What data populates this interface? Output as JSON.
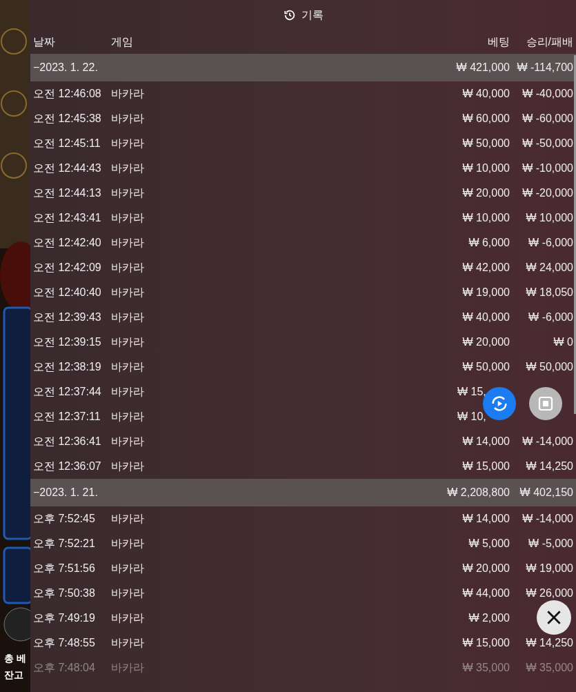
{
  "title": "기록",
  "columns": [
    "날짜",
    "게임",
    "베팅",
    "승리/패배"
  ],
  "groups": [
    {
      "date": "−2023. 1. 22.",
      "bet": "₩ 421,000",
      "win": "₩ -114,700",
      "rows": [
        {
          "time": "오전 12:46:08",
          "game": "바카라",
          "bet": "₩ 40,000",
          "win": "₩ -40,000"
        },
        {
          "time": "오전 12:45:38",
          "game": "바카라",
          "bet": "₩ 60,000",
          "win": "₩ -60,000"
        },
        {
          "time": "오전 12:45:11",
          "game": "바카라",
          "bet": "₩ 50,000",
          "win": "₩ -50,000"
        },
        {
          "time": "오전 12:44:43",
          "game": "바카라",
          "bet": "₩ 10,000",
          "win": "₩ -10,000"
        },
        {
          "time": "오전 12:44:13",
          "game": "바카라",
          "bet": "₩ 20,000",
          "win": "₩ -20,000"
        },
        {
          "time": "오전 12:43:41",
          "game": "바카라",
          "bet": "₩ 10,000",
          "win": "₩ 10,000"
        },
        {
          "time": "오전 12:42:40",
          "game": "바카라",
          "bet": "₩ 6,000",
          "win": "₩ -6,000"
        },
        {
          "time": "오전 12:42:09",
          "game": "바카라",
          "bet": "₩ 42,000",
          "win": "₩ 24,000"
        },
        {
          "time": "오전 12:40:40",
          "game": "바카라",
          "bet": "₩ 19,000",
          "win": "₩ 18,050"
        },
        {
          "time": "오전 12:39:43",
          "game": "바카라",
          "bet": "₩ 40,000",
          "win": "₩ -6,000"
        },
        {
          "time": "오전 12:39:15",
          "game": "바카라",
          "bet": "₩ 20,000",
          "win": "₩ 0"
        },
        {
          "time": "오전 12:38:19",
          "game": "바카라",
          "bet": "₩ 50,000",
          "win": "₩ 50,000"
        },
        {
          "time": "오전 12:37:44",
          "game": "바카라",
          "bet": "₩ 15,",
          "covered": true
        },
        {
          "time": "오전 12:37:11",
          "game": "바카라",
          "bet": "₩ 10,",
          "covered": true
        },
        {
          "time": "오전 12:36:41",
          "game": "바카라",
          "bet": "₩ 14,000",
          "win": "₩ -14,000"
        },
        {
          "time": "오전 12:36:07",
          "game": "바카라",
          "bet": "₩ 15,000",
          "win": "₩ 14,250"
        }
      ]
    },
    {
      "date": "−2023. 1. 21.",
      "bet": "₩ 2,208,800",
      "win": "₩ 402,150",
      "rows": [
        {
          "time": "오후 7:52:45",
          "game": "바카라",
          "bet": "₩ 14,000",
          "win": "₩ -14,000"
        },
        {
          "time": "오후 7:52:21",
          "game": "바카라",
          "bet": "₩ 5,000",
          "win": "₩ -5,000"
        },
        {
          "time": "오후 7:51:56",
          "game": "바카라",
          "bet": "₩ 20,000",
          "win": "₩ 19,000"
        },
        {
          "time": "오후 7:50:38",
          "game": "바카라",
          "bet": "₩ 44,000",
          "win": "₩ 26,000"
        },
        {
          "time": "오후 7:49:19",
          "game": "바카라",
          "bet": "₩ 2,000"
        },
        {
          "time": "오후 7:48:55",
          "game": "바카라",
          "bet": "₩ 15,000",
          "win": "₩ 14,250"
        },
        {
          "time": "오후 7:48:04",
          "game": "바카라",
          "bet": "₩ 35,000",
          "win": "₩ 35,000",
          "faded": true
        }
      ]
    }
  ],
  "background": {
    "labels": [
      "총 베",
      "잔고"
    ]
  }
}
